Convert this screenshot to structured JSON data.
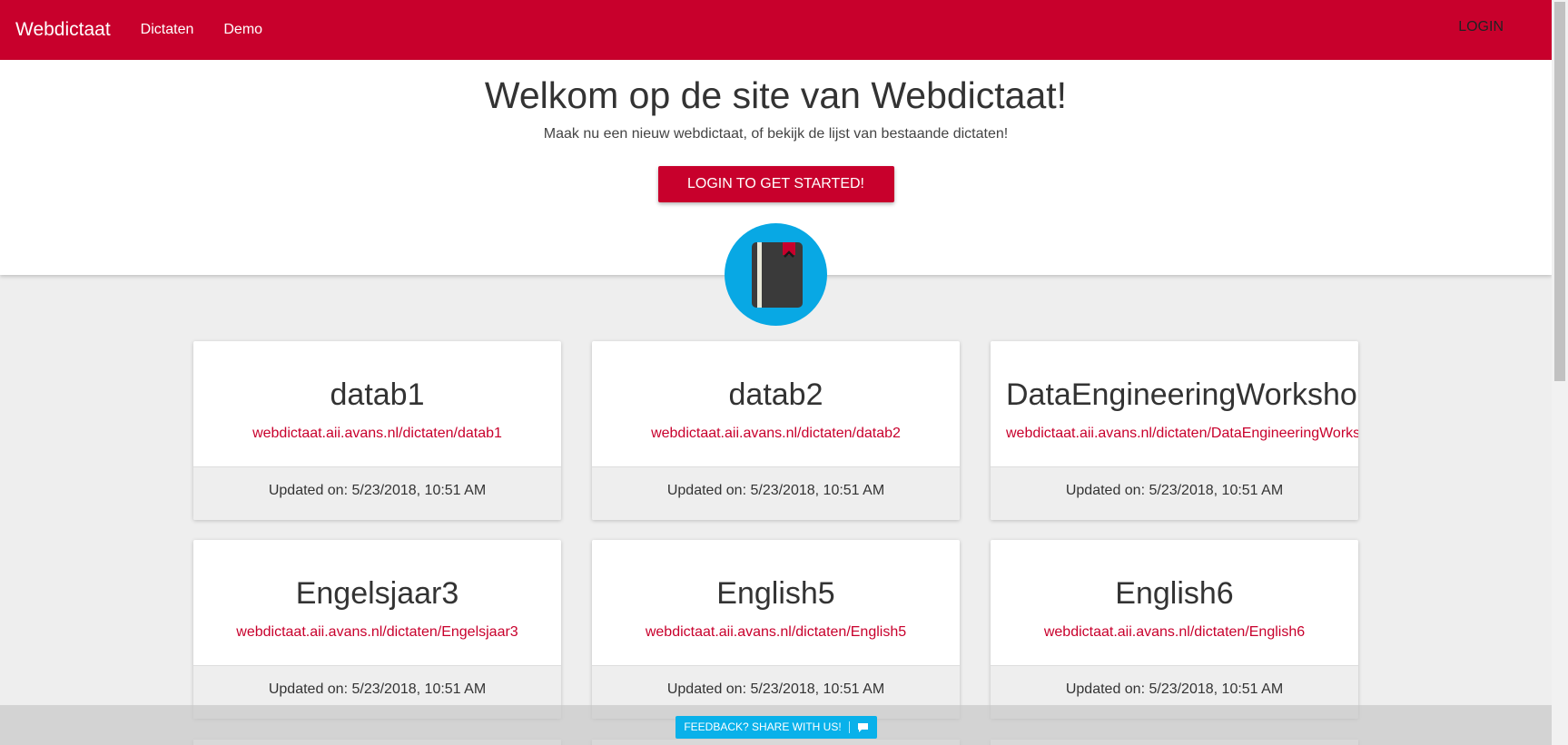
{
  "nav": {
    "brand": "Webdictaat",
    "links": [
      "Dictaten",
      "Demo"
    ],
    "login": "LOGIN"
  },
  "hero": {
    "title": "Welkom op de site van Webdictaat!",
    "subtitle": "Maak nu een nieuw webdictaat, of bekijk de lijst van bestaande dictaten!",
    "cta": "LOGIN TO GET STARTED!"
  },
  "logo": {
    "icon": "notebook-icon"
  },
  "cards": [
    {
      "title": "datab1",
      "link": "webdictaat.aii.avans.nl/dictaten/datab1",
      "updated": "Updated on: 5/23/2018, 10:51 AM"
    },
    {
      "title": "datab2",
      "link": "webdictaat.aii.avans.nl/dictaten/datab2",
      "updated": "Updated on: 5/23/2018, 10:51 AM"
    },
    {
      "title": "DataEngineeringWorkshop",
      "link": "webdictaat.aii.avans.nl/dictaten/DataEngineeringWorkshop",
      "updated": "Updated on: 5/23/2018, 10:51 AM"
    },
    {
      "title": "Engelsjaar3",
      "link": "webdictaat.aii.avans.nl/dictaten/Engelsjaar3",
      "updated": "Updated on: 5/23/2018, 10:51 AM"
    },
    {
      "title": "English5",
      "link": "webdictaat.aii.avans.nl/dictaten/English5",
      "updated": "Updated on: 5/23/2018, 10:51 AM"
    },
    {
      "title": "English6",
      "link": "webdictaat.aii.avans.nl/dictaten/English6",
      "updated": "Updated on: 5/23/2018, 10:51 AM"
    }
  ],
  "feedback": {
    "label": "FEEDBACK? SHARE WITH US!",
    "icon": "chat-icon"
  },
  "colors": {
    "primary": "#c8002c",
    "accent": "#08a8e4",
    "background": "#eeeeee"
  }
}
